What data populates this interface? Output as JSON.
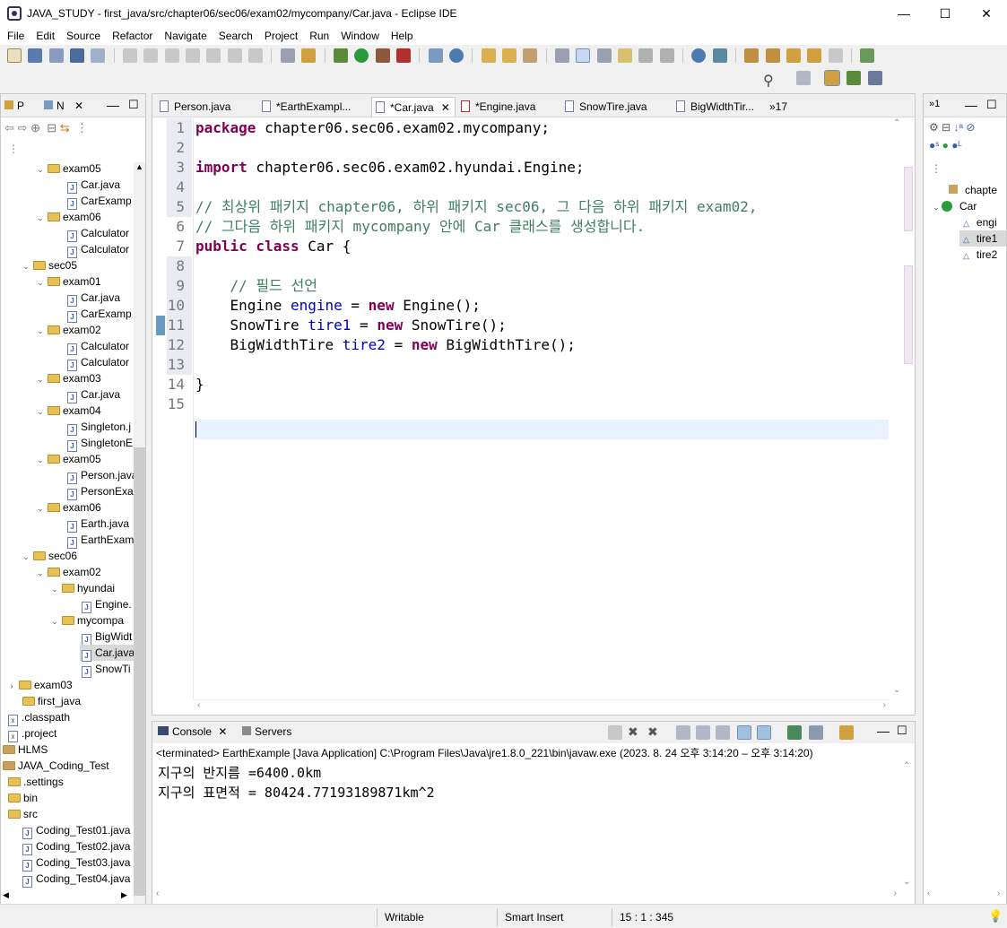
{
  "window": {
    "title": "JAVA_STUDY - first_java/src/chapter06/sec06/exam02/mycompany/Car.java - Eclipse IDE"
  },
  "menu": [
    "File",
    "Edit",
    "Source",
    "Refactor",
    "Navigate",
    "Search",
    "Project",
    "Run",
    "Window",
    "Help"
  ],
  "left_panel": {
    "tab1": "P",
    "tab2": "N",
    "tree": [
      {
        "label": "exam05",
        "type": "folder",
        "arrow": "⌄"
      },
      {
        "label": "Car.java",
        "type": "java"
      },
      {
        "label": "CarExamp",
        "type": "java"
      },
      {
        "label": "exam06",
        "type": "folder",
        "arrow": "⌄"
      },
      {
        "label": "Calculator",
        "type": "java"
      },
      {
        "label": "Calculator",
        "type": "java"
      },
      {
        "label": "sec05",
        "type": "folder",
        "arrow": "⌄"
      },
      {
        "label": "exam01",
        "type": "folder",
        "arrow": "⌄"
      },
      {
        "label": "Car.java",
        "type": "java"
      },
      {
        "label": "CarExamp",
        "type": "java"
      },
      {
        "label": "exam02",
        "type": "folder",
        "arrow": "⌄"
      },
      {
        "label": "Calculator",
        "type": "java"
      },
      {
        "label": "Calculator",
        "type": "java"
      },
      {
        "label": "exam03",
        "type": "folder",
        "arrow": "⌄"
      },
      {
        "label": "Car.java",
        "type": "java"
      },
      {
        "label": "exam04",
        "type": "folder",
        "arrow": "⌄"
      },
      {
        "label": "Singleton.j",
        "type": "java"
      },
      {
        "label": "SingletonE",
        "type": "java"
      },
      {
        "label": "exam05",
        "type": "folder",
        "arrow": "⌄"
      },
      {
        "label": "Person.java",
        "type": "java"
      },
      {
        "label": "PersonExa",
        "type": "java"
      },
      {
        "label": "exam06",
        "type": "folder",
        "arrow": "⌄"
      },
      {
        "label": "Earth.java",
        "type": "java"
      },
      {
        "label": "EarthExam",
        "type": "java"
      },
      {
        "label": "sec06",
        "type": "folder",
        "arrow": "⌄"
      },
      {
        "label": "exam02",
        "type": "folder",
        "arrow": "⌄"
      },
      {
        "label": "hyundai",
        "type": "folder",
        "arrow": "⌄"
      },
      {
        "label": "Engine.",
        "type": "java"
      },
      {
        "label": "mycompa",
        "type": "folder",
        "arrow": "⌄"
      },
      {
        "label": "BigWidt",
        "type": "java"
      },
      {
        "label": "Car.java",
        "type": "java"
      },
      {
        "label": "SnowTi",
        "type": "java"
      },
      {
        "label": "exam03",
        "type": "folder",
        "arrow": "›"
      },
      {
        "label": "first_java",
        "type": "folder"
      },
      {
        "label": ".classpath",
        "type": "x"
      },
      {
        "label": ".project",
        "type": "x"
      },
      {
        "label": "HLMS",
        "type": "project"
      },
      {
        "label": "JAVA_Coding_Test",
        "type": "project"
      },
      {
        "label": ".settings",
        "type": "folder"
      },
      {
        "label": "bin",
        "type": "folder"
      },
      {
        "label": "src",
        "type": "folder"
      },
      {
        "label": "Coding_Test01.java",
        "type": "java"
      },
      {
        "label": "Coding_Test02.java",
        "type": "java"
      },
      {
        "label": "Coding_Test03.java",
        "type": "java"
      },
      {
        "label": "Coding_Test04.java",
        "type": "java"
      }
    ]
  },
  "editor": {
    "tabs": [
      "Person.java",
      "*EarthExampl...",
      "*Car.java",
      "*Engine.java",
      "SnowTire.java",
      "BigWidthTir..."
    ],
    "more_tabs": "»17",
    "lines": [
      "1",
      "2",
      "3",
      "4",
      "5",
      "6",
      "7",
      "8",
      "9",
      "10",
      "11",
      "12",
      "13",
      "14",
      "15"
    ],
    "code": {
      "l1_kw": "package",
      "l1_rest": " chapter06.sec06.exam02.mycompany;",
      "l3_kw": "import",
      "l3_rest": " chapter06.sec06.exam02.hyundai.Engine;",
      "l5": "// 최상위 패키지 chapter06, 하위 패키지 sec06, 그 다음 하위 패키지 exam02,",
      "l6": "// 그다음 하위 패키지 mycompany 안에 Car 클래스를 생성합니다.",
      "l7_kw": "public class",
      "l7_rest": " Car {",
      "l9": "    // 필드 선언",
      "l10_a": "    Engine ",
      "l10_f": "engine",
      "l10_b": " = ",
      "l10_kw": "new",
      "l10_c": " Engine();",
      "l11_a": "    SnowTire ",
      "l11_f": "tire1",
      "l11_b": " = ",
      "l11_kw": "new",
      "l11_c": " SnowTire();",
      "l12_a": "    BigWidthTire ",
      "l12_f": "tire2",
      "l12_b": " = ",
      "l12_kw": "new",
      "l12_c": " BigWidthTire();",
      "l14": "}"
    }
  },
  "console": {
    "tab1": "Console",
    "tab2": "Servers",
    "header": "<terminated> EarthExample [Java Application] C:\\Program Files\\Java\\jre1.8.0_221\\bin\\javaw.exe  (2023. 8. 24 오후 3:14:20 – 오후 3:14:20)",
    "output": [
      "지구의 반지름 =6400.0km",
      "지구의 표면적 = 80424.77193189871km^2"
    ]
  },
  "outline": {
    "tab": "»1",
    "items": [
      "chapte",
      "Car",
      "engi",
      "tire1",
      "tire2"
    ]
  },
  "status": {
    "writable": "Writable",
    "insert": "Smart Insert",
    "position": "15 : 1 : 345"
  },
  "colors": {
    "keyword": "#7f0055",
    "comment": "#3f7f5f",
    "field": "#0000c0"
  }
}
